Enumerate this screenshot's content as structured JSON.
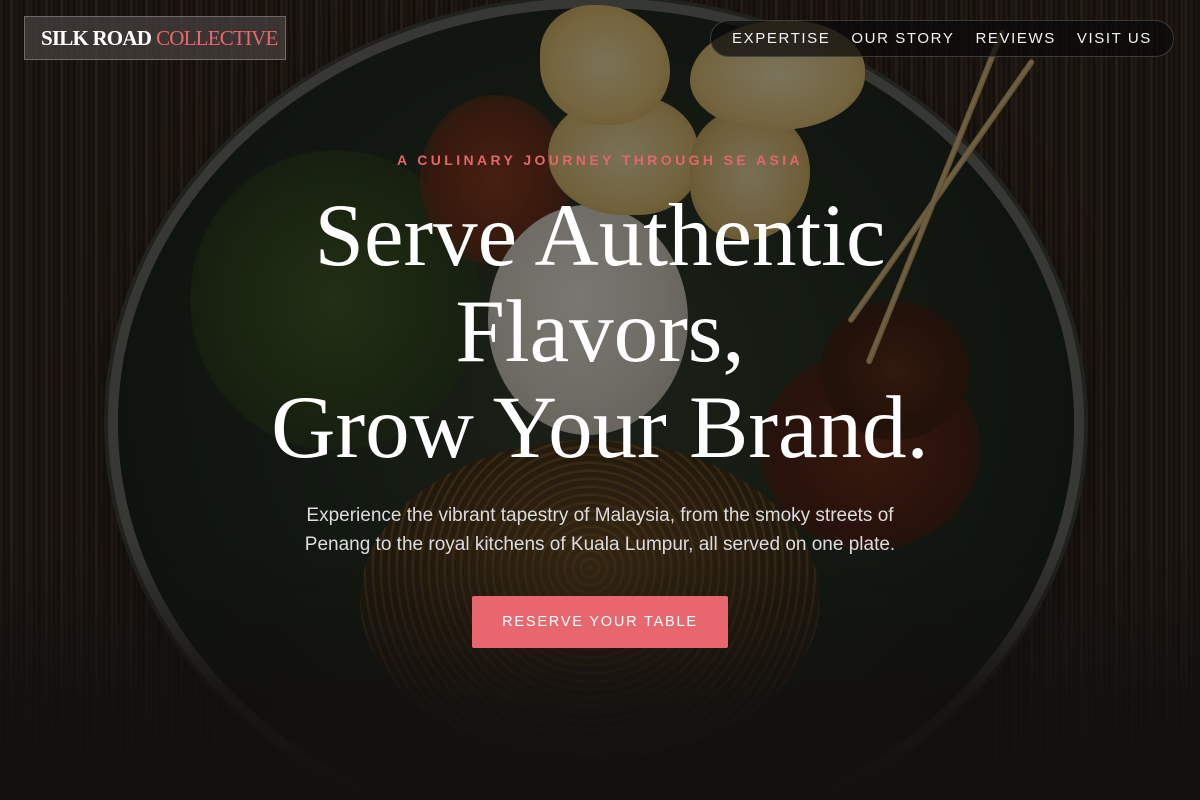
{
  "brand": {
    "name_part1": "SILK ROAD",
    "name_part2": "COLLECTIVE"
  },
  "nav": {
    "items": [
      {
        "label": "EXPERTISE"
      },
      {
        "label": "OUR STORY"
      },
      {
        "label": "REVIEWS"
      },
      {
        "label": "VISIT US"
      }
    ]
  },
  "hero": {
    "eyebrow": "A CULINARY JOURNEY THROUGH SE ASIA",
    "title_lines": [
      "Serve Authentic",
      "Flavors,",
      "Grow Your Brand."
    ],
    "subtitle_line1": "Experience the vibrant tapestry of Malaysia, from the smoky streets of",
    "subtitle_line2": "Penang to the royal kitchens of Kuala Lumpur, all served on one plate.",
    "cta_label": "RESERVE YOUR TABLE",
    "background_image": "nasi-lemak-plate-photo"
  },
  "colors": {
    "accent": "#e8676e",
    "text": "#ffffff",
    "background": "#141210"
  }
}
